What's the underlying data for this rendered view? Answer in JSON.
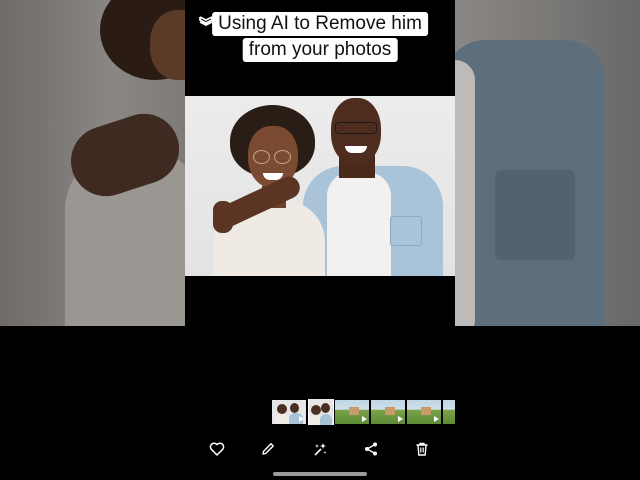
{
  "caption": {
    "line1": "Using AI to Remove him",
    "line2": "from your photos"
  },
  "toolbar": {
    "items": [
      {
        "name": "favorite",
        "icon": "heart-icon"
      },
      {
        "name": "edit",
        "icon": "pencil-icon"
      },
      {
        "name": "magic-eraser",
        "icon": "sparkle-icon"
      },
      {
        "name": "share",
        "icon": "share-icon"
      },
      {
        "name": "delete",
        "icon": "trash-icon"
      }
    ]
  },
  "thumbnails": [
    {
      "type": "people",
      "video": true
    },
    {
      "type": "people",
      "selected": true
    },
    {
      "type": "field",
      "video": true
    },
    {
      "type": "field",
      "video": true
    },
    {
      "type": "field",
      "video": true
    },
    {
      "type": "field",
      "video": false
    }
  ],
  "colors": {
    "background": "#000000",
    "caption_bg": "#ffffff",
    "photo_bg": "#e8e8e8",
    "icon": "#ffffff"
  }
}
